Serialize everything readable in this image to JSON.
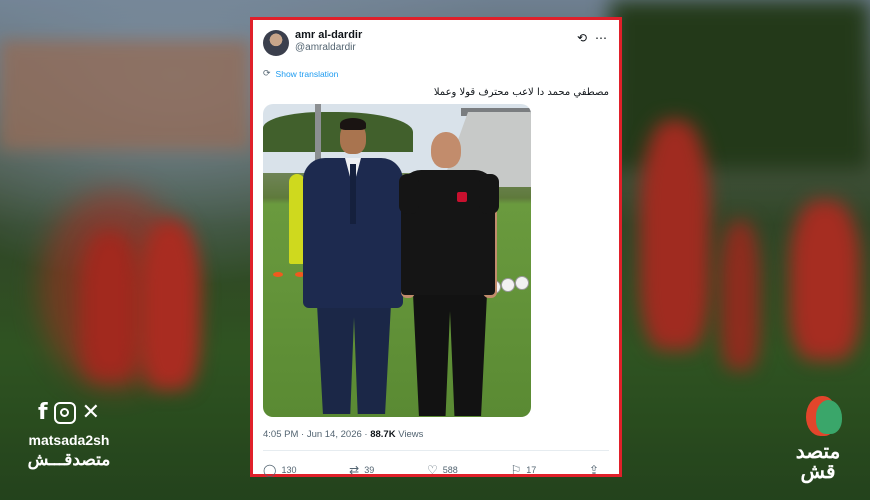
{
  "tweet": {
    "author_name": "amr al-dardir",
    "author_handle": "@amraldardir",
    "show_translation": "Show translation",
    "text": "مصطفي محمد دا لاعب محترف قولا وعملا",
    "timestamp": "4:05 PM · Jun 14, 2026 ·",
    "views_count": "88.7K",
    "views_label": "Views",
    "replies": "130",
    "reposts": "39",
    "likes": "588",
    "bookmarks": "17"
  },
  "icons": {
    "grok": "grok-icon",
    "more": "more-icon",
    "translate": "globe-icon",
    "reply": "reply-icon",
    "repost": "repost-icon",
    "like": "heart-icon",
    "bookmark": "bookmark-icon",
    "share": "share-icon"
  },
  "social": {
    "handle": "matsada2sh",
    "arabic_name": "متصدقـــش"
  },
  "brand": {
    "logo_text": "متصد قش"
  },
  "colors": {
    "frame_border": "#e0202a",
    "link_blue": "#1d9bf0",
    "muted_text": "#536471"
  }
}
